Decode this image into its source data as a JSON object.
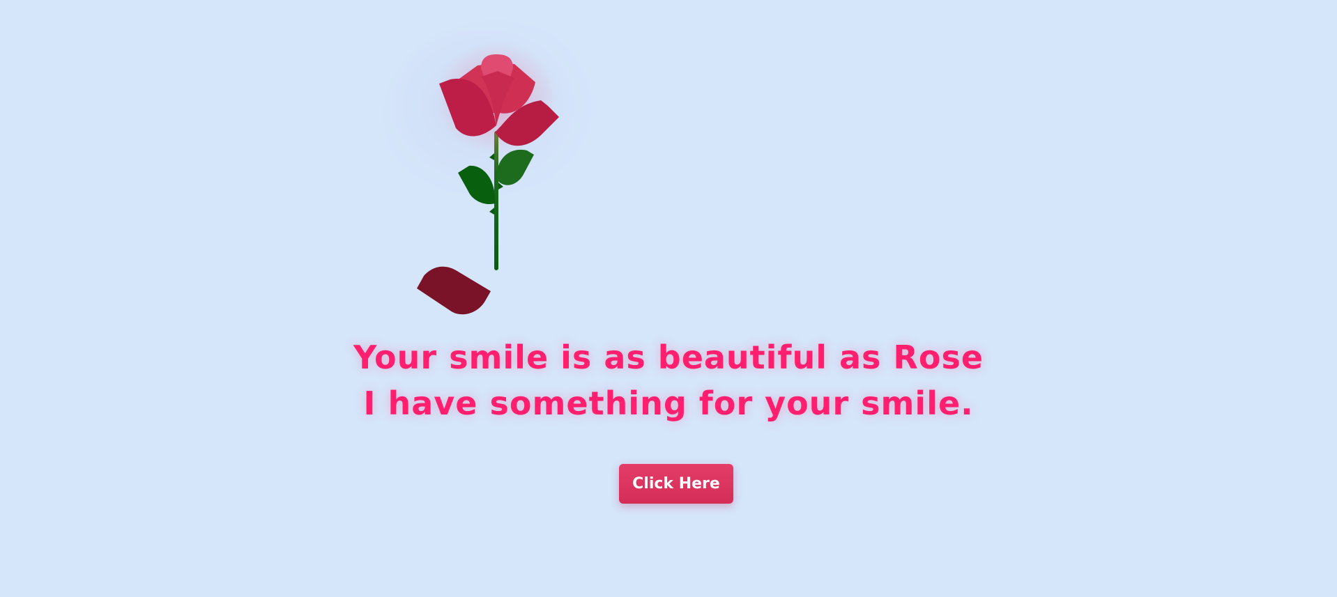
{
  "greeting": {
    "line1": "Your smile is as beautiful as Rose",
    "line2": "I have something for your smile."
  },
  "cta": {
    "label": "Click Here"
  },
  "colors": {
    "background": "#d5e5fa",
    "text": "#ff1f6e",
    "button": "#d9325d",
    "petal": "#c71f48",
    "leaf": "#0a6a14",
    "fallen_petal": "#7a1228"
  },
  "icons": {
    "rose": "rose-icon",
    "fallen_petal": "fallen-petal-icon"
  }
}
